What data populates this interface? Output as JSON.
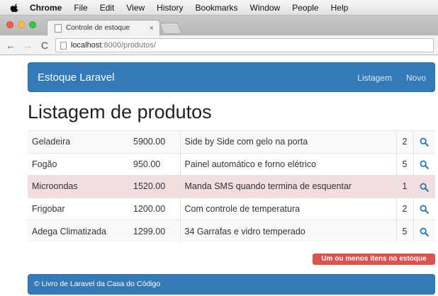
{
  "menubar": {
    "app": "Chrome",
    "items": [
      "File",
      "Edit",
      "View",
      "History",
      "Bookmarks",
      "Window",
      "People",
      "Help"
    ]
  },
  "browser": {
    "tab_title": "Controle de estoque",
    "tab_close": "×",
    "url_host": "localhost",
    "url_path": ":8000/produtos/"
  },
  "navbar": {
    "brand": "Estoque Laravel",
    "links": [
      "Listagem",
      "Novo"
    ]
  },
  "page": {
    "title": "Listagem de produtos"
  },
  "produtos": [
    {
      "nome": "Geladeira",
      "valor": "5900.00",
      "descricao": "Side by Side com gelo na porta",
      "quantidade": "2",
      "low_stock": false
    },
    {
      "nome": "Fogão",
      "valor": "950.00",
      "descricao": "Painel automático e forno elétrico",
      "quantidade": "5",
      "low_stock": false
    },
    {
      "nome": "Microondas",
      "valor": "1520.00",
      "descricao": "Manda SMS quando termina de esquentar",
      "quantidade": "1",
      "low_stock": true
    },
    {
      "nome": "Frigobar",
      "valor": "1200.00",
      "descricao": "Com controle de temperatura",
      "quantidade": "2",
      "low_stock": false
    },
    {
      "nome": "Adega Climatizada",
      "valor": "1299.00",
      "descricao": "34 Garrafas e vidro temperado",
      "quantidade": "5",
      "low_stock": false
    }
  ],
  "warning": "Um ou menos itens no estoque",
  "footer": "© Livro de Laravel da Casa do Código",
  "colors": {
    "primary": "#337ab7",
    "danger": "#d9534f",
    "danger_row": "#f2dede"
  }
}
